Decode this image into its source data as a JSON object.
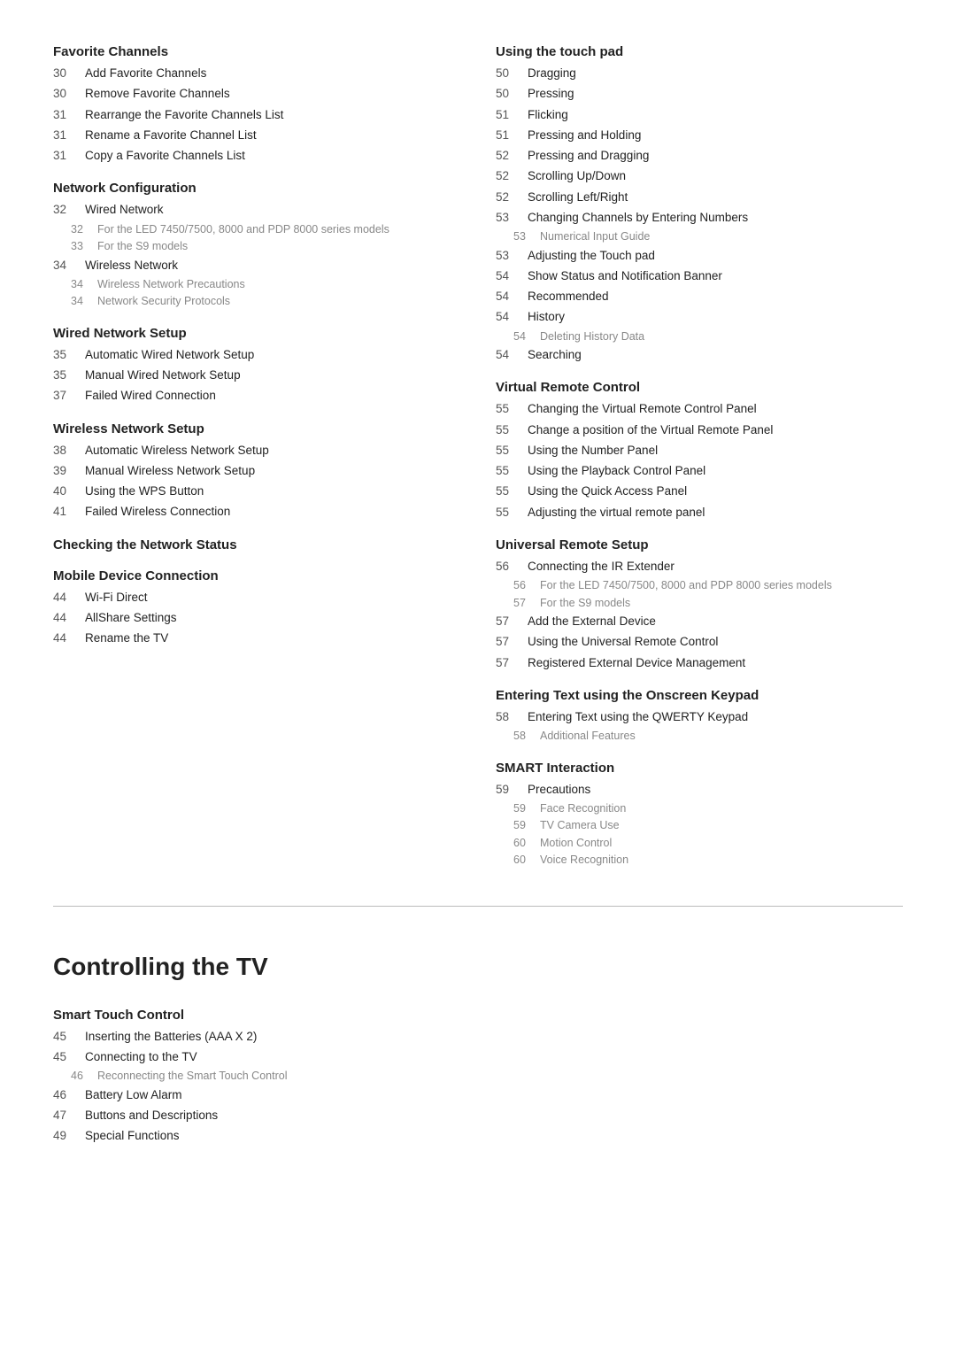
{
  "left_col": {
    "sections": [
      {
        "heading": "Favorite Channels",
        "entries": [
          {
            "num": "30",
            "label": "Add Favorite Channels"
          },
          {
            "num": "30",
            "label": "Remove Favorite Channels"
          },
          {
            "num": "31",
            "label": "Rearrange the Favorite Channels List"
          },
          {
            "num": "31",
            "label": "Rename a Favorite Channel List"
          },
          {
            "num": "31",
            "label": "Copy a Favorite Channels List"
          }
        ]
      },
      {
        "heading": "Network Configuration",
        "entries": [],
        "subsections": [
          {
            "label": "Wired Network",
            "num": "32",
            "items": [
              {
                "num": "32",
                "label": "For the LED 7450/7500, 8000 and PDP 8000 series models"
              },
              {
                "num": "33",
                "label": "For the S9 models"
              }
            ]
          },
          {
            "label": "Wireless Network",
            "num": "34",
            "items": [
              {
                "num": "34",
                "label": "Wireless Network Precautions"
              },
              {
                "num": "34",
                "label": "Network Security Protocols"
              }
            ]
          }
        ]
      },
      {
        "heading": "Wired Network Setup",
        "entries": [
          {
            "num": "35",
            "label": "Automatic Wired Network Setup"
          },
          {
            "num": "35",
            "label": "Manual Wired Network Setup"
          },
          {
            "num": "37",
            "label": "Failed Wired Connection"
          }
        ]
      },
      {
        "heading": "Wireless Network Setup",
        "entries": [
          {
            "num": "38",
            "label": "Automatic Wireless Network Setup"
          },
          {
            "num": "39",
            "label": "Manual Wireless Network Setup"
          },
          {
            "num": "40",
            "label": "Using the WPS Button"
          },
          {
            "num": "41",
            "label": "Failed Wireless Connection"
          }
        ]
      },
      {
        "heading": "Checking the Network Status",
        "entries": []
      },
      {
        "heading": "Mobile Device Connection",
        "entries": [
          {
            "num": "44",
            "label": "Wi-Fi Direct"
          },
          {
            "num": "44",
            "label": "AllShare Settings"
          },
          {
            "num": "44",
            "label": "Rename the TV"
          }
        ]
      }
    ],
    "big_section": {
      "heading": "Controlling the TV",
      "subsections": [
        {
          "heading": "Smart Touch Control",
          "entries": [
            {
              "num": "45",
              "label": "Inserting the Batteries (AAA X 2)"
            },
            {
              "num": "45",
              "label": "Connecting to the TV",
              "subitems": [
                {
                  "num": "46",
                  "label": "Reconnecting the Smart Touch Control"
                }
              ]
            },
            {
              "num": "46",
              "label": "Battery Low Alarm"
            },
            {
              "num": "47",
              "label": "Buttons and Descriptions"
            },
            {
              "num": "49",
              "label": "Special Functions"
            }
          ]
        }
      ]
    }
  },
  "right_col": {
    "sections": [
      {
        "heading": "Using the touch pad",
        "entries": [
          {
            "num": "50",
            "label": "Dragging"
          },
          {
            "num": "50",
            "label": "Pressing"
          },
          {
            "num": "51",
            "label": "Flicking"
          },
          {
            "num": "51",
            "label": "Pressing and Holding"
          },
          {
            "num": "52",
            "label": "Pressing and Dragging"
          },
          {
            "num": "52",
            "label": "Scrolling Up/Down"
          },
          {
            "num": "52",
            "label": "Scrolling Left/Right"
          },
          {
            "num": "53",
            "label": "Changing Channels by Entering Numbers",
            "subitems": [
              {
                "num": "53",
                "label": "Numerical Input Guide"
              }
            ]
          },
          {
            "num": "53",
            "label": "Adjusting the Touch pad"
          },
          {
            "num": "54",
            "label": "Show Status and Notification Banner"
          },
          {
            "num": "54",
            "label": "Recommended"
          },
          {
            "num": "54",
            "label": "History",
            "subitems": [
              {
                "num": "54",
                "label": "Deleting History Data"
              }
            ]
          },
          {
            "num": "54",
            "label": "Searching"
          }
        ]
      },
      {
        "heading": "Virtual Remote Control",
        "entries": [
          {
            "num": "55",
            "label": "Changing the Virtual Remote Control Panel"
          },
          {
            "num": "55",
            "label": "Change a position of the Virtual Remote Panel"
          },
          {
            "num": "55",
            "label": "Using the Number Panel"
          },
          {
            "num": "55",
            "label": "Using the Playback Control Panel"
          },
          {
            "num": "55",
            "label": "Using the Quick Access Panel"
          },
          {
            "num": "55",
            "label": "Adjusting the virtual remote panel"
          }
        ]
      },
      {
        "heading": "Universal Remote Setup",
        "entries": [
          {
            "num": "56",
            "label": "Connecting the IR Extender",
            "subitems": [
              {
                "num": "56",
                "label": "For the LED 7450/7500, 8000 and PDP 8000 series models"
              },
              {
                "num": "57",
                "label": "For the S9 models"
              }
            ]
          },
          {
            "num": "57",
            "label": "Add the External Device"
          },
          {
            "num": "57",
            "label": "Using the Universal Remote Control"
          },
          {
            "num": "57",
            "label": "Registered External Device Management"
          }
        ]
      },
      {
        "heading": "Entering Text using the Onscreen Keypad",
        "entries": [
          {
            "num": "58",
            "label": "Entering Text using the QWERTY Keypad",
            "subitems": [
              {
                "num": "58",
                "label": "Additional Features"
              }
            ]
          }
        ]
      },
      {
        "heading": "SMART Interaction",
        "entries": [
          {
            "num": "59",
            "label": "Precautions",
            "subitems": [
              {
                "num": "59",
                "label": "Face Recognition"
              },
              {
                "num": "59",
                "label": "TV Camera Use"
              },
              {
                "num": "60",
                "label": "Motion Control"
              },
              {
                "num": "60",
                "label": "Voice Recognition"
              }
            ]
          }
        ]
      }
    ]
  }
}
